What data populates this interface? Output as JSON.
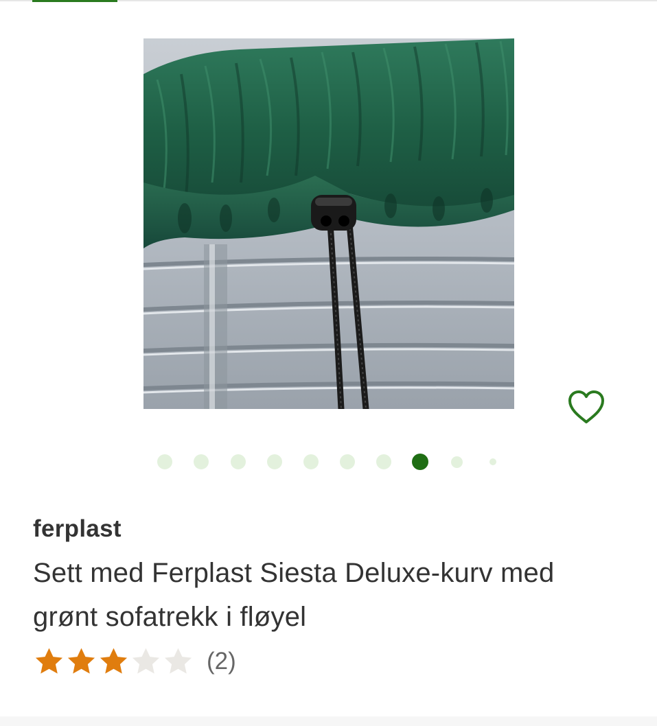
{
  "product": {
    "brand": "ferplast",
    "title": "Sett med Ferplast Siesta Deluxe-kurv med grønt sofatrekk i fløyel",
    "image_alt": "Sett med Ferplast Siesta Deluxe-kurv med grønt sofatrekk i fløyel"
  },
  "gallery": {
    "image_count": 10,
    "active_index": 7
  },
  "rating": {
    "stars": 3,
    "max": 5,
    "review_count": "(2)"
  },
  "icons": {
    "wishlist": "heart-outline-icon",
    "star": "star-icon"
  },
  "colors": {
    "accent": "#2a7a1f",
    "dot_active": "#1f6e14",
    "dot_inactive": "#e3f1dd",
    "star_filled": "#e07d0e",
    "star_empty": "#eae8e4",
    "text": "#333333",
    "muted": "#666666"
  }
}
